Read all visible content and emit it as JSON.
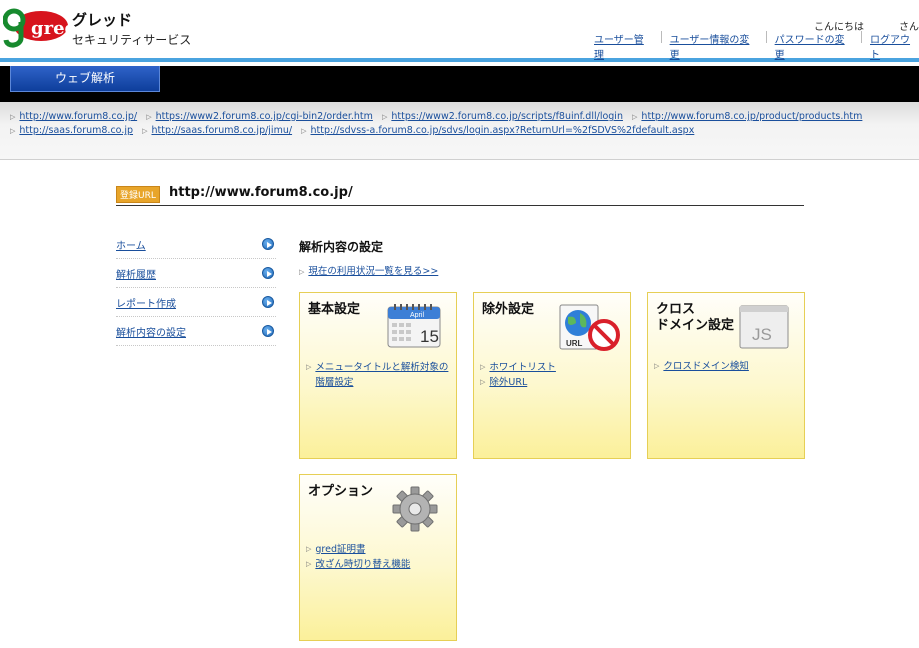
{
  "header": {
    "logo_text": "gred",
    "brand_name": "グレッド",
    "brand_sub": "セキュリティサービス",
    "greeting": "こんにちは",
    "greeting_suffix": "さん",
    "links": [
      "ユーザー管理",
      "ユーザー情報の変更",
      "パスワードの変更",
      "ログアウト"
    ]
  },
  "nav": {
    "active_tab": "ウェブ解析"
  },
  "recent_urls": [
    "http://www.forum8.co.jp/",
    "https://www2.forum8.co.jp/cgi-bin2/order.htm",
    "https://www2.forum8.co.jp/scripts/f8uinf.dll/login",
    "http://www.forum8.co.jp/product/products.htm",
    "http://saas.forum8.co.jp",
    "http://saas.forum8.co.jp/jimu/",
    "http://sdvss-a.forum8.co.jp/sdvs/login.aspx?ReturnUrl=%2fSDVS%2fdefault.aspx"
  ],
  "registered": {
    "badge": "登録URL",
    "url": "http://www.forum8.co.jp/"
  },
  "sidebar": {
    "items": [
      {
        "label": "ホーム"
      },
      {
        "label": "解析履歴"
      },
      {
        "label": "レポート作成"
      },
      {
        "label": "解析内容の設定"
      }
    ]
  },
  "main": {
    "title": "解析内容の設定",
    "status_link": "現在の利用状況一覧を見る>>",
    "cards": [
      {
        "title": "基本設定",
        "links": [
          "メニュータイトルと解析対象の階層設定"
        ],
        "icon": "calendar-icon",
        "calendar_month": "April",
        "calendar_day": "15"
      },
      {
        "title": "除外設定",
        "links": [
          "ホワイトリスト",
          "除外URL"
        ],
        "icon": "url-block-icon",
        "icon_text": "URL"
      },
      {
        "title_line1": "クロス",
        "title_line2": "ドメイン設定",
        "links": [
          "クロスドメイン検知"
        ],
        "icon": "js-file-icon",
        "icon_text": "JS"
      },
      {
        "title": "オプション",
        "links": [
          "gred証明書",
          "改ざん時切り替え機能"
        ],
        "icon": "gear-icon"
      }
    ]
  },
  "colors": {
    "header_rule": "#4aa3df",
    "nav_bg": "#000000",
    "nav_tab": "#1a4fb5",
    "badge": "#e8a52a",
    "card_border": "#e6cf55",
    "card_fill": "#fdf8cf",
    "link": "#1a4f9c"
  }
}
